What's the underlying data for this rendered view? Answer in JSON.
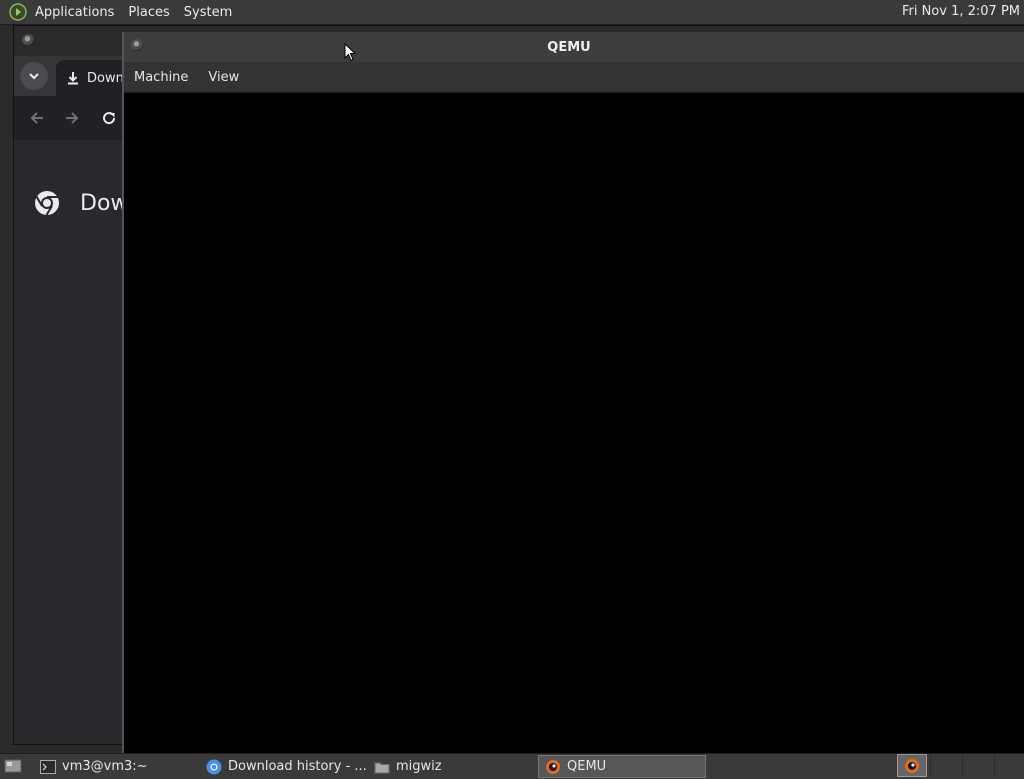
{
  "top_panel": {
    "menus": [
      "Applications",
      "Places",
      "System"
    ],
    "clock": "Fri Nov 1,  2:07 PM"
  },
  "chrome": {
    "tab_title": "Downl",
    "page_title": "Dow"
  },
  "qemu": {
    "title": "QEMU",
    "menus": [
      "Machine",
      "View"
    ]
  },
  "taskbar": {
    "items": [
      {
        "label": "vm3@vm3:~",
        "icon": "terminal-icon"
      },
      {
        "label": "Download history - ...",
        "icon": "chrome-icon"
      },
      {
        "label": "migwiz",
        "icon": "folder-icon"
      },
      {
        "label": "QEMU",
        "icon": "qemu-icon",
        "active": true
      }
    ]
  },
  "colors": {
    "panel_bg": "#3a3a3a",
    "qemu_display": "#000000",
    "chrome_bg": "#202124"
  }
}
